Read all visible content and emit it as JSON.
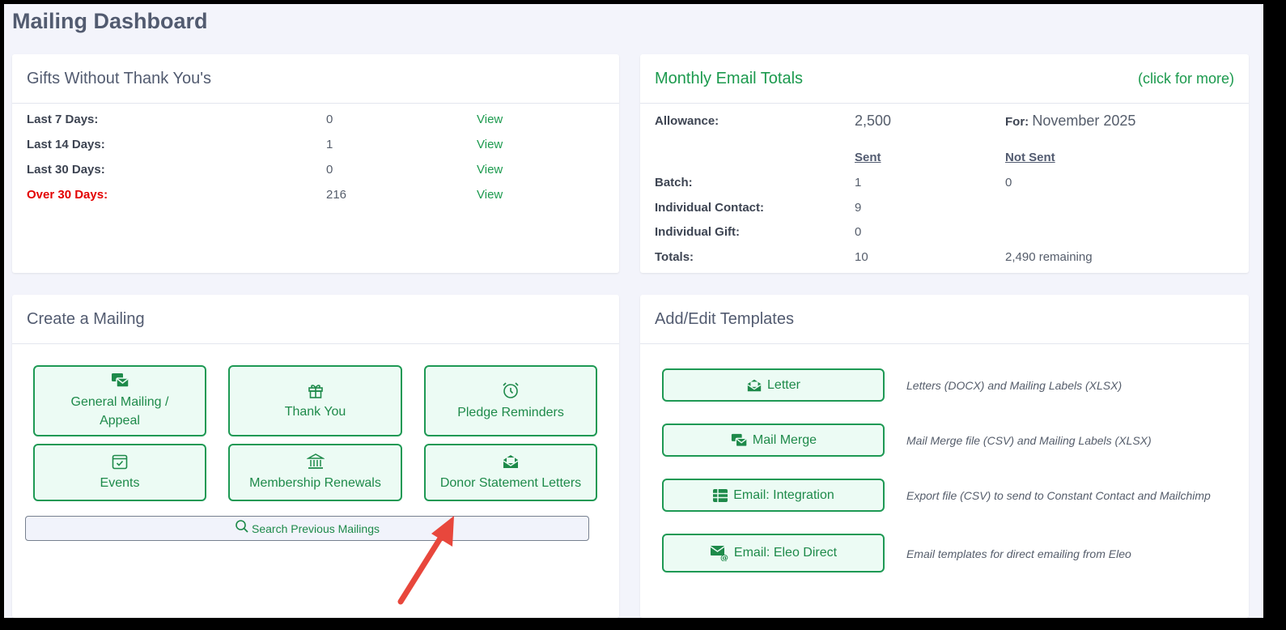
{
  "page": {
    "title": "Mailing Dashboard"
  },
  "gifts": {
    "title": "Gifts Without Thank You's",
    "rows": [
      {
        "label": "Last 7 Days:",
        "value": "0",
        "link": "View"
      },
      {
        "label": "Last 14 Days:",
        "value": "1",
        "link": "View"
      },
      {
        "label": "Last 30 Days:",
        "value": "0",
        "link": "View"
      },
      {
        "label": "Over 30 Days:",
        "value": "216",
        "link": "View"
      }
    ]
  },
  "email_totals": {
    "title": "Monthly Email Totals",
    "more_link": "(click for more)",
    "allowance_label": "Allowance:",
    "allowance_value": "2,500",
    "for_label": "For:",
    "for_value": "November 2025",
    "col_sent": "Sent",
    "col_not_sent": "Not Sent",
    "rows": [
      {
        "label": "Batch:",
        "sent": "1",
        "not_sent": "0"
      },
      {
        "label": "Individual Contact:",
        "sent": "9",
        "not_sent": ""
      },
      {
        "label": "Individual Gift:",
        "sent": "0",
        "not_sent": ""
      },
      {
        "label": "Totals:",
        "sent": "10",
        "not_sent": "2,490 remaining"
      }
    ]
  },
  "create": {
    "title": "Create a Mailing",
    "tiles": [
      {
        "label": "General Mailing / Appeal",
        "icon": "mail-stack-icon"
      },
      {
        "label": "Thank You",
        "icon": "gift-icon"
      },
      {
        "label": "Pledge Reminders",
        "icon": "alarm-clock-icon"
      },
      {
        "label": "Events",
        "icon": "calendar-check-icon"
      },
      {
        "label": "Membership Renewals",
        "icon": "bank-icon"
      },
      {
        "label": "Donor Statement Letters",
        "icon": "envelope-letter-icon"
      }
    ],
    "search_label": "Search Previous Mailings"
  },
  "templates": {
    "title": "Add/Edit Templates",
    "items": [
      {
        "label": "Letter",
        "icon": "envelope-letter-icon",
        "desc": "Letters (DOCX) and Mailing Labels (XLSX)"
      },
      {
        "label": "Mail Merge",
        "icon": "mail-stack-icon",
        "desc": "Mail Merge file (CSV) and Mailing Labels (XLSX)"
      },
      {
        "label": "Email: Integration",
        "icon": "table-icon",
        "desc": "Export file (CSV) to send to Constant Contact and Mailchimp"
      },
      {
        "label": "Email: Eleo Direct",
        "icon": "email-at-icon",
        "desc": "Email templates for direct emailing from Eleo"
      }
    ]
  },
  "colors": {
    "accent": "#1c9a4e",
    "warning": "#e30000",
    "arrow": "#e8473c"
  }
}
